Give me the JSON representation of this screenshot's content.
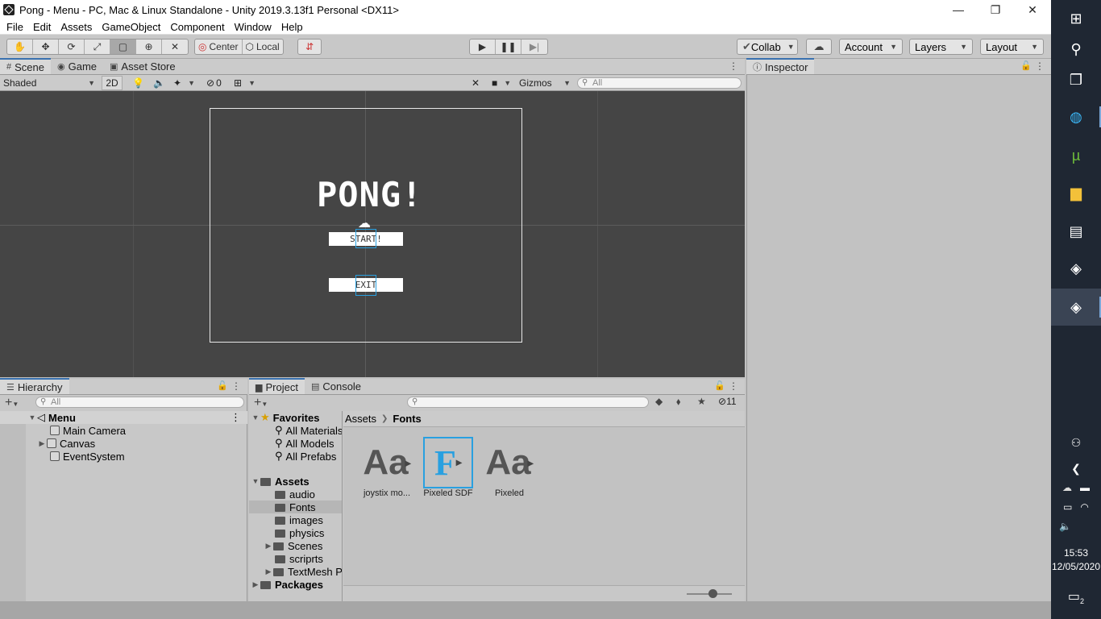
{
  "window": {
    "title": "Pong - Menu - PC, Mac & Linux Standalone - Unity 2019.3.13f1 Personal <DX11>",
    "minimize": "—",
    "maximize": "❐",
    "close": "✕"
  },
  "menubar": [
    "File",
    "Edit",
    "Assets",
    "GameObject",
    "Component",
    "Window",
    "Help"
  ],
  "toolbar": {
    "pivot": "Center",
    "space": "Local",
    "collab": "Collab",
    "account": "Account",
    "layers": "Layers",
    "layout": "Layout"
  },
  "scene_tabs": [
    "Scene",
    "Game",
    "Asset Store"
  ],
  "scene_toolbar": {
    "shading": "Shaded",
    "mode2d": "2D",
    "hidden_count": "0",
    "gizmos": "Gizmos",
    "search_placeholder": "All"
  },
  "scene": {
    "title": "PONG!",
    "start_button": "START!",
    "exit_button": "EXIT"
  },
  "inspector": {
    "tab": "Inspector"
  },
  "hierarchy": {
    "tab": "Hierarchy",
    "search_placeholder": "All",
    "scene_name": "Menu",
    "items": [
      "Main Camera",
      "Canvas",
      "EventSystem"
    ]
  },
  "project": {
    "tabs": [
      "Project",
      "Console"
    ],
    "visible_count": "11",
    "favorites_label": "Favorites",
    "favorites": [
      "All Materials",
      "All Models",
      "All Prefabs"
    ],
    "assets_label": "Assets",
    "folders": [
      "audio",
      "Fonts",
      "images",
      "physics",
      "Scenes",
      "scriprts",
      "TextMesh P"
    ],
    "packages_label": "Packages",
    "breadcrumb": [
      "Assets",
      "Fonts"
    ],
    "files": [
      {
        "name": "joystix mo...",
        "glyph": "Aa"
      },
      {
        "name": "Pixeled SDF",
        "glyph": "F"
      },
      {
        "name": "Pixeled",
        "glyph": "Aa"
      }
    ]
  },
  "taskbar": {
    "time": "15:53",
    "date": "12/05/2020",
    "notifications": "2"
  },
  "colors": {
    "accent": "#29a0e0",
    "scene_bg": "#454545",
    "taskbar_bg": "#1f2733"
  }
}
